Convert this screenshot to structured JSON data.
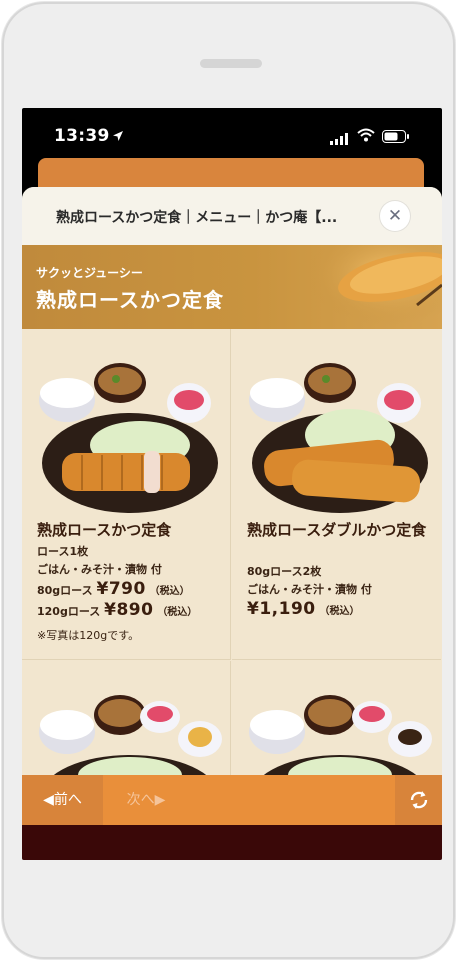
{
  "status_bar": {
    "time": "13:39"
  },
  "sheet": {
    "title": "熟成ロースかつ定食｜メニュー｜かつ庵【...",
    "close_glyph": "✕"
  },
  "banner": {
    "subtitle": "サクッとジューシー",
    "title": "熟成ロースかつ定食"
  },
  "menu_items": [
    {
      "name": "熟成ロースかつ定食",
      "line1": "ロース1枚",
      "line2": "ごはん・みそ汁・漬物 付",
      "price1_label": "80gロース",
      "price1": "¥790",
      "price2_label": "120gロース",
      "price2": "¥890",
      "tax": "（税込）",
      "note": "※写真は120gです。"
    },
    {
      "name": "熟成ロースダブルかつ定食",
      "line1": "80gロース2枚",
      "line2": "ごはん・みそ汁・漬物 付",
      "price1": "¥1,190",
      "tax": "（税込）"
    }
  ],
  "footer": {
    "prev_label": "前へ",
    "next_label": "次へ"
  },
  "colors": {
    "accent": "#e98f3a",
    "banner": "#c9943f",
    "dark_text": "#3a1e0e"
  }
}
